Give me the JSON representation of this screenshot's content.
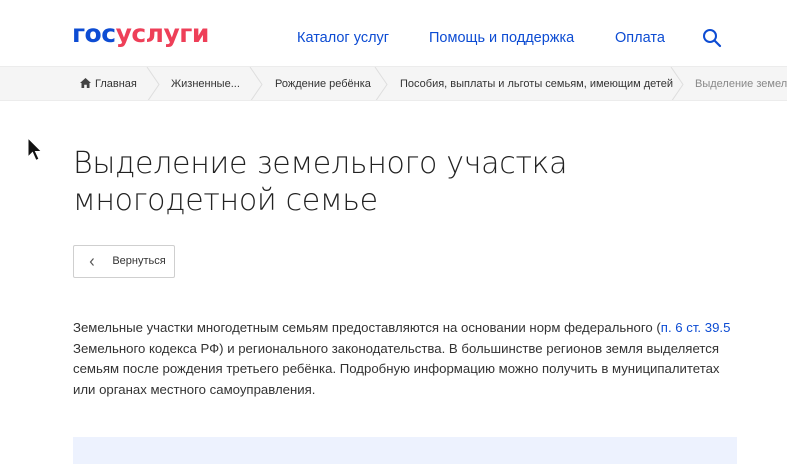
{
  "header": {
    "logo_part1": "гос",
    "logo_part2": "услуги",
    "nav": {
      "catalog": "Каталог услуг",
      "help": "Помощь и поддержка",
      "payment": "Оплата"
    },
    "search_icon": "search-icon"
  },
  "breadcrumb": {
    "items": [
      "Главная",
      "Жизненные...",
      "Рождение ребёнка",
      "Пособия, выплаты и льготы семьям, имеющим детей",
      "Выделение земельного участка многодетной семье"
    ]
  },
  "page": {
    "title_line1": "Выделение земельного участка",
    "title_line2": "многодетной семье",
    "back_label": "Вернуться",
    "description": {
      "text_before": "Земельные участки многодетным семьям предоставляются на основании норм федерального (",
      "link": "п. 6 ст. 39.5",
      "text_after": " Земельного кодекса РФ) и регионального законодательства. В большинстве регионов земля выделяется семьям после рождения третьего ребёнка. Подробную информацию можно получить в муниципалитетах или органах местного самоуправления."
    }
  },
  "colors": {
    "brand_blue": "#0d4cd3",
    "brand_red": "#ee3f58",
    "breadcrumb_bg": "#f5f5f5",
    "info_bg": "#edf2fe"
  }
}
